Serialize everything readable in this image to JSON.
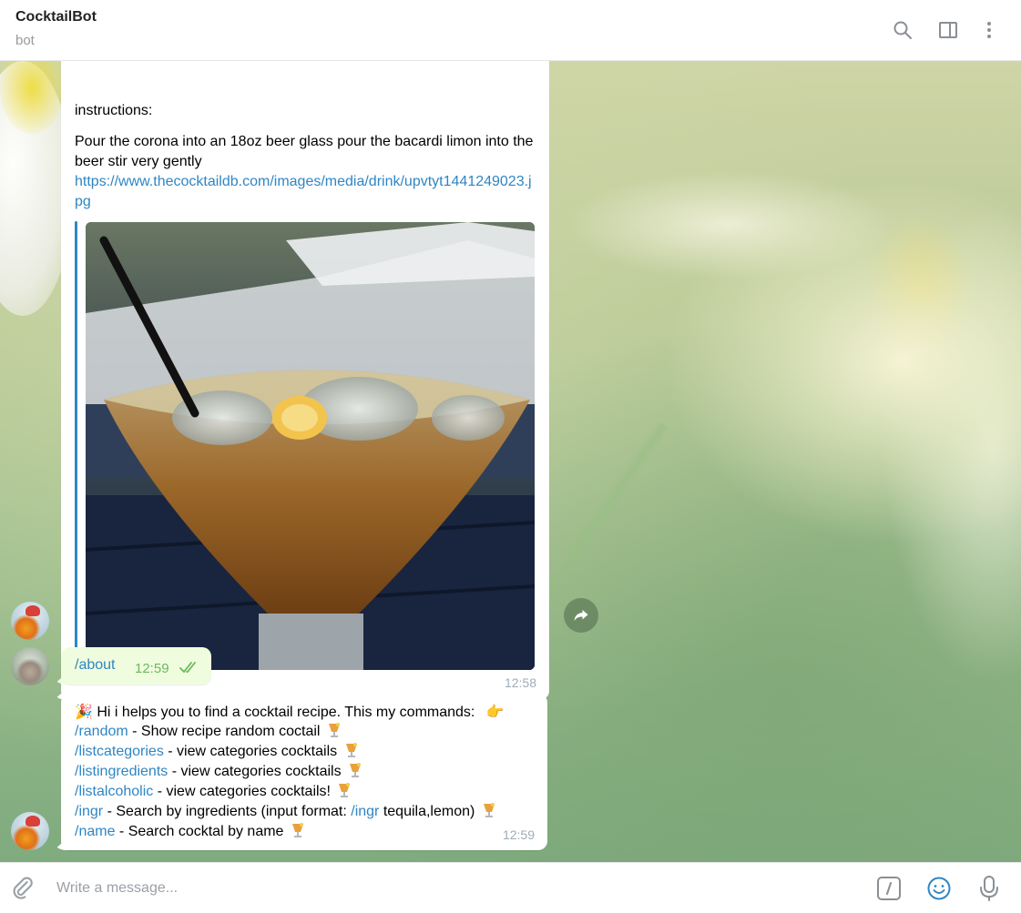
{
  "header": {
    "title": "CocktailBot",
    "subtitle": "bot",
    "icons": [
      "search-icon",
      "side-panel-icon",
      "more-vertical-icon"
    ]
  },
  "messages": {
    "recipe": {
      "instructions_label": "instructions:",
      "instructions_text": "Pour the corona into an 18oz beer glass pour the bacardi limon into the beer stir very gently",
      "image_url": "https://www.thecocktaildb.com/images/media/drink/upvtyt1441249023.jpg",
      "time": "12:58"
    },
    "about": {
      "command": "/about",
      "time": "12:59",
      "status": "read"
    },
    "help": {
      "intro": "Hi i helps you to find a cocktail recipe. This my commands:",
      "commands": [
        {
          "cmd": "/random",
          "desc": " - Show recipe random coctail"
        },
        {
          "cmd": "/listcategories",
          "desc": " - view categories cocktails"
        },
        {
          "cmd": "/listingredients",
          "desc": " - view categories cocktails"
        },
        {
          "cmd": "/listalcoholic",
          "desc": " - view categories cocktails!"
        },
        {
          "cmd": "/ingr",
          "desc": " - Search by ingredients (input format: ",
          "cmd2": "/ingr",
          "desc2": " tequila,lemon)"
        },
        {
          "cmd": "/name",
          "desc": " - Search cocktal by name"
        }
      ],
      "time": "12:59"
    }
  },
  "composer": {
    "placeholder": "Write a message..."
  },
  "colors": {
    "accent": "#2f86c4",
    "outgoing_bubble": "#effdde",
    "read_ticks": "#6cb860"
  }
}
